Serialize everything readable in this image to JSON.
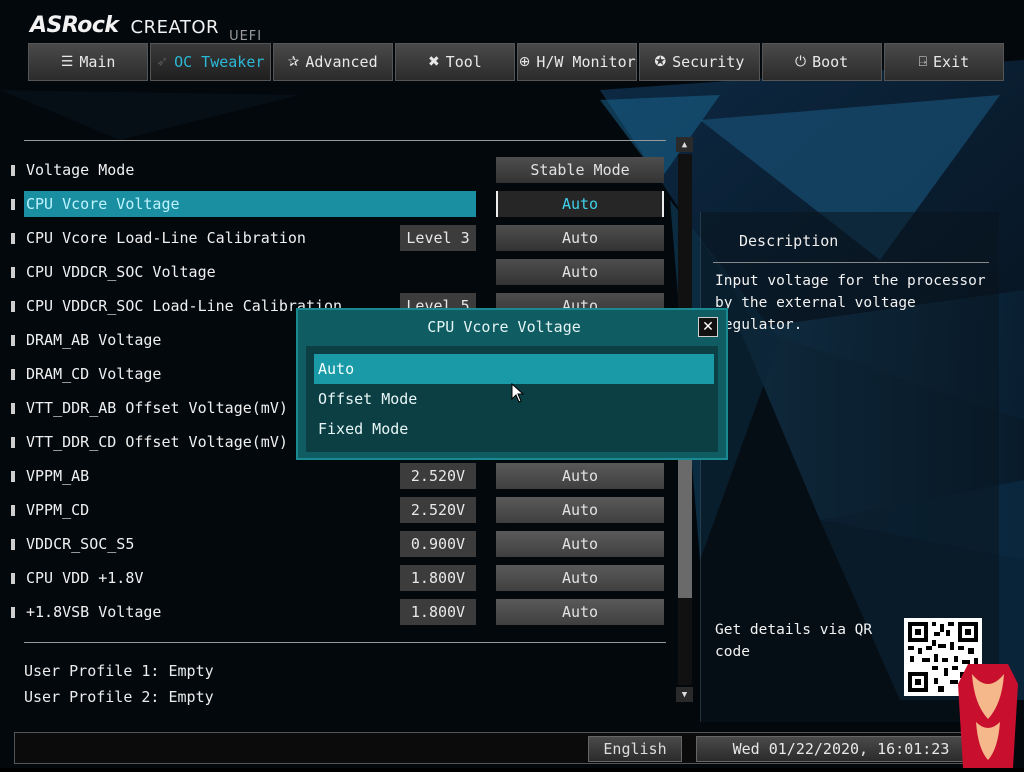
{
  "header": {
    "brand": "ASRock",
    "model": "CREATOR",
    "firmware": "UEFI"
  },
  "tabs": [
    {
      "label": "Main",
      "icon": "list-icon",
      "active": false
    },
    {
      "label": "OC Tweaker",
      "icon": "rocket-icon",
      "active": true
    },
    {
      "label": "Advanced",
      "icon": "star-icon",
      "active": false
    },
    {
      "label": "Tool",
      "icon": "tools-icon",
      "active": false
    },
    {
      "label": "H/W Monitor",
      "icon": "monitor-icon",
      "active": false
    },
    {
      "label": "Security",
      "icon": "shield-icon",
      "active": false
    },
    {
      "label": "Boot",
      "icon": "power-icon",
      "active": false
    },
    {
      "label": "Exit",
      "icon": "exit-icon",
      "active": false
    }
  ],
  "settings": [
    {
      "label": "Voltage Mode",
      "current": "",
      "option": "Stable Mode"
    },
    {
      "label": "CPU Vcore Voltage",
      "current": "",
      "option": "Auto"
    },
    {
      "label": "CPU Vcore Load-Line Calibration",
      "current": "Level 3",
      "option": "Auto"
    },
    {
      "label": "CPU VDDCR_SOC Voltage",
      "current": "",
      "option": "Auto"
    },
    {
      "label": "CPU VDDCR_SOC Load-Line Calibration",
      "current": "Level 5",
      "option": "Auto"
    },
    {
      "label": "DRAM_AB Voltage",
      "current": "",
      "option": ""
    },
    {
      "label": "DRAM_CD Voltage",
      "current": "",
      "option": ""
    },
    {
      "label": "VTT_DDR_AB Offset Voltage(mV)",
      "current": "",
      "option": ""
    },
    {
      "label": "VTT_DDR_CD Offset Voltage(mV)",
      "current": "",
      "option": ""
    },
    {
      "label": "VPPM_AB",
      "current": "2.520V",
      "option": "Auto"
    },
    {
      "label": "VPPM_CD",
      "current": "2.520V",
      "option": "Auto"
    },
    {
      "label": "VDDCR_SOC_S5",
      "current": "0.900V",
      "option": "Auto"
    },
    {
      "label": "CPU VDD +1.8V",
      "current": "1.800V",
      "option": "Auto"
    },
    {
      "label": "+1.8VSB Voltage",
      "current": "1.800V",
      "option": "Auto"
    }
  ],
  "profiles": [
    "User Profile 1: Empty",
    "User Profile 2: Empty"
  ],
  "description": {
    "title": "Description",
    "text": "Input voltage for the processor by the external voltage regulator.",
    "qr_text": "Get details via QR code"
  },
  "footer": {
    "language": "English",
    "datetime": "Wed 01/22/2020, 16:01:23"
  },
  "popup": {
    "title": "CPU Vcore Voltage",
    "options": [
      "Auto",
      "Offset Mode",
      "Fixed Mode"
    ],
    "selected_index": 0
  },
  "colors": {
    "accent": "#2ab8d6",
    "highlight": "#1a8fa2",
    "popup_bg": "#0f5d63"
  }
}
